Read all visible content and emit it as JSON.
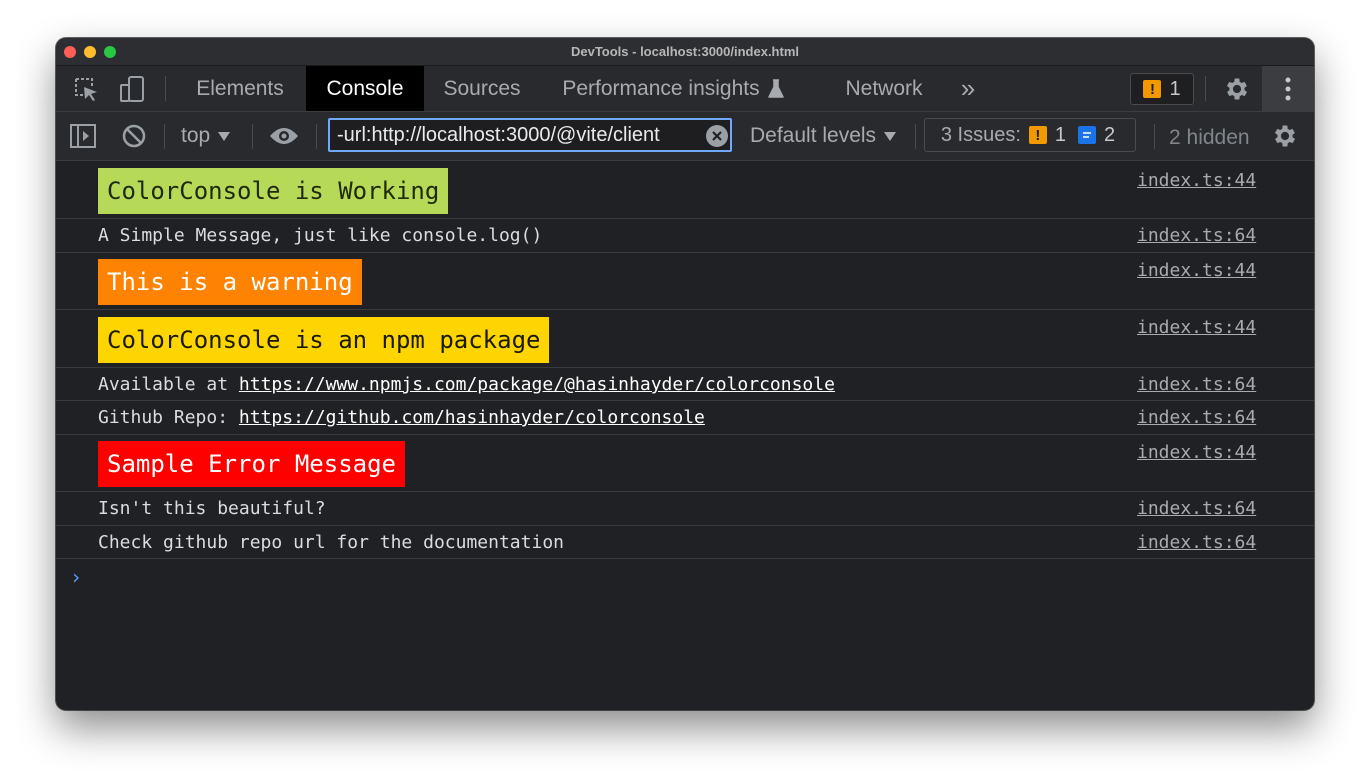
{
  "window": {
    "title": "DevTools - localhost:3000/index.html"
  },
  "tabs": [
    {
      "label": "Elements"
    },
    {
      "label": "Console"
    },
    {
      "label": "Sources"
    },
    {
      "label": "Performance insights"
    },
    {
      "label": "Network"
    }
  ],
  "header": {
    "more_tabs": "»",
    "issues_badge_count": "1"
  },
  "toolbar": {
    "context": "top",
    "filter_value": "-url:http://localhost:3000/@vite/client",
    "levels": "Default levels",
    "issues_label": "3 Issues:",
    "issues_warnings": "1",
    "issues_messages": "2",
    "hidden_count": "2 hidden"
  },
  "colors": {
    "green": "#b6d957",
    "orange": "#ff8303",
    "yellow": "#ffd500",
    "red": "#ff0000"
  },
  "messages": [
    {
      "text": "ColorConsole is Working",
      "source": "index.ts:44"
    },
    {
      "text": "A Simple Message, just like console.log()",
      "source": "index.ts:64"
    },
    {
      "text": "This is a warning",
      "source": "index.ts:44"
    },
    {
      "text": "ColorConsole is an npm package",
      "source": "index.ts:44"
    },
    {
      "prefix": "Available at ",
      "link": "https://www.npmjs.com/package/@hasinhayder/colorconsole",
      "source": "index.ts:64"
    },
    {
      "prefix": "Github Repo: ",
      "link": "https://github.com/hasinhayder/colorconsole",
      "source": "index.ts:64"
    },
    {
      "text": "Sample Error Message",
      "source": "index.ts:44"
    },
    {
      "text": "Isn't this beautiful?",
      "source": "index.ts:64"
    },
    {
      "text": "Check github repo url for the documentation",
      "source": "index.ts:64"
    }
  ],
  "prompt": "›"
}
